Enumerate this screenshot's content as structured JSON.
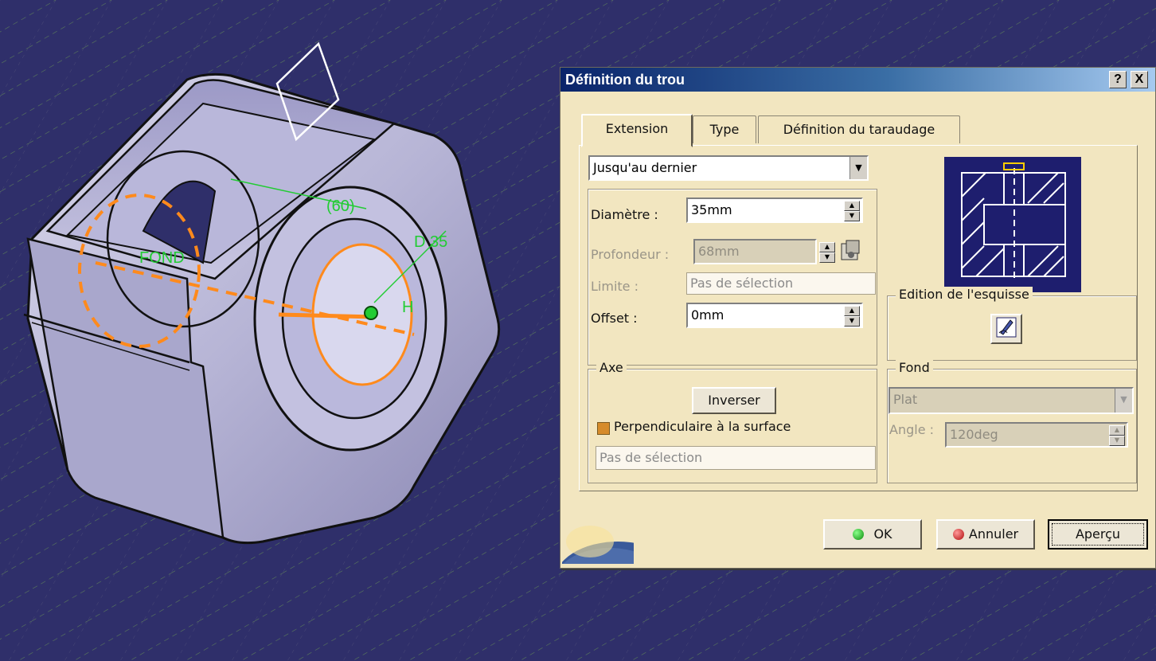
{
  "dialog": {
    "title": "Définition du trou",
    "help_label": "?",
    "close_label": "X"
  },
  "model": {
    "labels": {
      "fond": "FOND",
      "dim60": "(60)",
      "diam": "D 35",
      "h": "H"
    }
  },
  "tabs": [
    {
      "label": "Extension",
      "active": true
    },
    {
      "label": "Type",
      "active": false
    },
    {
      "label": "Définition du taraudage",
      "active": false
    }
  ],
  "extension": {
    "limit_type": "Jusqu'au dernier",
    "diameter_label": "Diamètre :",
    "diameter_value": "35mm",
    "depth_label": "Profondeur :",
    "depth_value": "68mm",
    "limit_label": "Limite :",
    "limit_value": "Pas de sélection",
    "offset_label": "Offset :",
    "offset_value": "0mm"
  },
  "sketch": {
    "group_label": "Edition de l'esquisse"
  },
  "axis": {
    "group_label": "Axe",
    "reverse_button": "Inverser",
    "perpendicular_label": "Perpendiculaire à la surface",
    "perpendicular_checked": true,
    "selection_value": "Pas de sélection"
  },
  "bottom": {
    "group_label": "Fond",
    "type_value": "Plat",
    "angle_label": "Angle :",
    "angle_value": "120deg"
  },
  "footer": {
    "ok_label": "OK",
    "cancel_label": "Annuler",
    "preview_label": "Aperçu"
  },
  "colors": {
    "accent_orange": "#ff8a1c",
    "dimension_green": "#22cc33",
    "viewport_bg": "#2f2f6a"
  }
}
